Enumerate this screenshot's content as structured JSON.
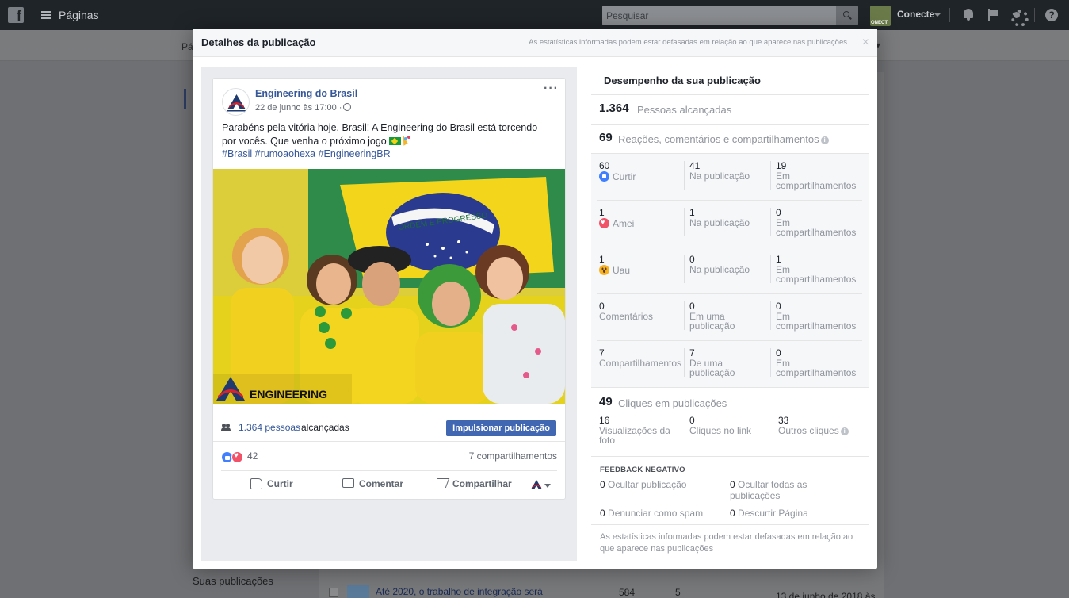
{
  "topbar": {
    "pages_title": "Páginas",
    "search_placeholder": "Pesquisar",
    "profile_name": "Conecte",
    "profile_logo_text": "ONECT"
  },
  "background": {
    "subnav_left": "Pá",
    "suas_publicacoes": "Suas publicações",
    "row_title": "Até 2020, o trabalho de integração será",
    "row_num1": "584",
    "row_num2": "5",
    "row_date": "13 de junho de 2018 às"
  },
  "modal": {
    "title": "Detalhes da publicação",
    "header_note": "As estatísticas informadas podem estar defasadas em relação ao que aparece nas publicações",
    "close": "×"
  },
  "post": {
    "author": "Engineering do Brasil",
    "date": "22 de junho às 17:00 ·",
    "text_line1": "Parabéns pela vitória hoje, Brasil! A Engineering do Brasil está torcendo",
    "text_line2": "por vocês. Que venha o próximo jogo",
    "hashtags": "#Brasil #rumoaohexa #EngineeringBR",
    "image_banner": "ORDEM E PROGRESSO",
    "image_brand": "ENGINEERING",
    "reach_count": "1.364 pessoas",
    "reach_word": "alcançadas",
    "boost_label": "Impulsionar publicação",
    "reactions_count": "42",
    "shares": "7 compartilhamentos",
    "actions": {
      "like": "Curtir",
      "comment": "Comentar",
      "share": "Compartilhar"
    }
  },
  "stats": {
    "title": "Desempenho da sua publicação",
    "reach_num": "1.364",
    "reach_label": "Pessoas alcançadas",
    "engagement_num": "69",
    "engagement_label": "Reações, comentários e compartilhamentos",
    "rows": [
      {
        "n1": "60",
        "l1": "Curtir",
        "n2": "41",
        "l2": "Na publicação",
        "n3": "19",
        "l3": "Em compartilhamentos"
      },
      {
        "n1": "1",
        "l1": "Amei",
        "n2": "1",
        "l2": "Na publicação",
        "n3": "0",
        "l3": "Em compartilhamentos"
      },
      {
        "n1": "1",
        "l1": "Uau",
        "n2": "0",
        "l2": "Na publicação",
        "n3": "1",
        "l3": "Em compartilhamentos"
      },
      {
        "n1": "0",
        "l1": "Comentários",
        "n2": "0",
        "l2": "Em uma publicação",
        "n3": "0",
        "l3": "Em compartilhamentos"
      },
      {
        "n1": "7",
        "l1": "Compartilhamentos",
        "n2": "7",
        "l2": "De uma publicação",
        "n3": "0",
        "l3": "Em compartilhamentos"
      }
    ],
    "clicks_num": "49",
    "clicks_label": "Cliques em publicações",
    "clicks": [
      {
        "n": "16",
        "l": "Visualizações da foto"
      },
      {
        "n": "0",
        "l": "Cliques no link"
      },
      {
        "n": "33",
        "l": "Outros cliques"
      }
    ],
    "negative_title": "FEEDBACK NEGATIVO",
    "negative": [
      {
        "n": "0",
        "l": "Ocultar publicação"
      },
      {
        "n": "0",
        "l": "Ocultar todas as publicações"
      },
      {
        "n": "0",
        "l": "Denunciar como spam"
      },
      {
        "n": "0",
        "l": "Descurtir Página"
      }
    ],
    "footer_note": "As estatísticas informadas podem estar defasadas em relação ao que aparece nas publicações"
  },
  "colors": {
    "brand_blue": "#4267b2",
    "link_blue": "#365899",
    "like_blue": "#4080ff",
    "love_red": "#f25268",
    "wow_yellow": "#f7b125",
    "brazil_green": "#179a3a",
    "brazil_yellow": "#f7d117"
  }
}
